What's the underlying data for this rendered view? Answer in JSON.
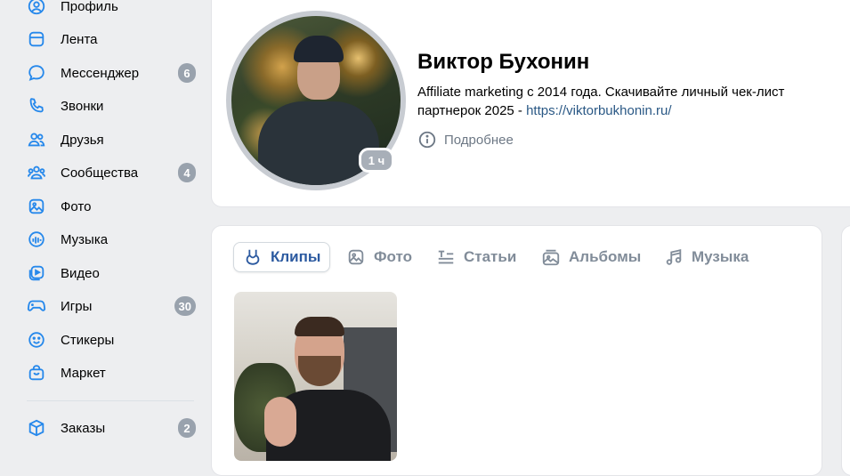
{
  "sidebar": {
    "items": [
      {
        "label": "Профиль",
        "icon": "user-circle-icon",
        "badge": ""
      },
      {
        "label": "Лента",
        "icon": "newsfeed-icon",
        "badge": ""
      },
      {
        "label": "Мессенджер",
        "icon": "message-icon",
        "badge": "6"
      },
      {
        "label": "Звонки",
        "icon": "phone-icon",
        "badge": ""
      },
      {
        "label": "Друзья",
        "icon": "friends-icon",
        "badge": ""
      },
      {
        "label": "Сообщества",
        "icon": "communities-icon",
        "badge": "4"
      },
      {
        "label": "Фото",
        "icon": "photo-icon",
        "badge": ""
      },
      {
        "label": "Музыка",
        "icon": "music-icon",
        "badge": ""
      },
      {
        "label": "Видео",
        "icon": "video-icon",
        "badge": ""
      },
      {
        "label": "Игры",
        "icon": "gamepad-icon",
        "badge": "30"
      },
      {
        "label": "Стикеры",
        "icon": "smile-icon",
        "badge": ""
      },
      {
        "label": "Маркет",
        "icon": "bag-icon",
        "badge": ""
      },
      {
        "label": "Заказы",
        "icon": "box-icon",
        "badge": "2"
      }
    ]
  },
  "profile": {
    "name": "Виктор Бухонин",
    "status_text": "Affiliate marketing с 2014 года. Скачивайте личный чек-лист партнерок 2025 - ",
    "status_link": "https://viktorbukhonin.ru/",
    "more_label": "Подробнее",
    "story_badge": "1 ч"
  },
  "tabs": [
    {
      "label": "Клипы",
      "icon": "clips-icon",
      "active": true
    },
    {
      "label": "Фото",
      "icon": "photo-icon",
      "active": false
    },
    {
      "label": "Статьи",
      "icon": "articles-icon",
      "active": false
    },
    {
      "label": "Альбомы",
      "icon": "albums-icon",
      "active": false
    },
    {
      "label": "Музыка",
      "icon": "music-note-icon",
      "active": false
    }
  ],
  "colors": {
    "accent": "#2c5aa0",
    "link": "#2a5885",
    "badge": "#99a2ad",
    "icon": "#2688eb",
    "page_bg": "#edeef0"
  }
}
